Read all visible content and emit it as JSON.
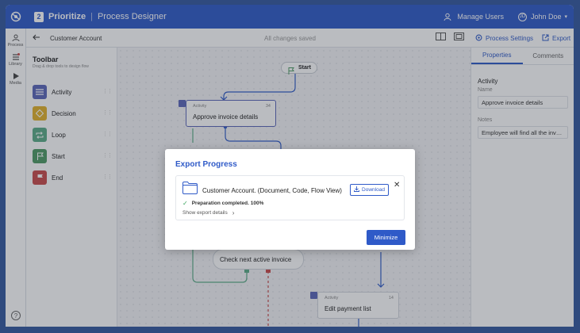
{
  "topbar": {
    "badge": "2",
    "app_name": "Prioritize",
    "separator": "|",
    "page_name": "Process Designer",
    "manage_users": "Manage Users",
    "user_initials": "JD",
    "user_name": "John Doe"
  },
  "leftrail": {
    "items": [
      {
        "label": "Process",
        "icon": "process-icon"
      },
      {
        "label": "Library",
        "icon": "library-icon"
      },
      {
        "label": "Media",
        "icon": "media-icon"
      }
    ],
    "help": "?"
  },
  "subbar": {
    "document": "Customer Account",
    "save_status": "All changes saved",
    "process_settings": "Process Settings",
    "export": "Export"
  },
  "toolbar": {
    "title": "Toolbar",
    "hint": "Drag & drop tools to design flow",
    "tools": [
      {
        "label": "Activity",
        "color": "#5b66b8",
        "icon": "list-icon"
      },
      {
        "label": "Decision",
        "color": "#e2b22a",
        "icon": "diamond-icon"
      },
      {
        "label": "Loop",
        "color": "#5bab86",
        "icon": "loop-icon"
      },
      {
        "label": "Start",
        "color": "#4d9a63",
        "icon": "flag-icon"
      },
      {
        "label": "End",
        "color": "#c94a4a",
        "icon": "flag-icon"
      }
    ]
  },
  "canvas": {
    "start": "Start",
    "nodes": [
      {
        "kind": "Activity",
        "number": "34",
        "name": "Approve invoice details"
      },
      {
        "kind": "",
        "number": "",
        "name": "Check next active invoice"
      },
      {
        "kind": "Activity",
        "number": "14",
        "name": "Edit payment list"
      }
    ]
  },
  "rightpanel": {
    "tabs": [
      "Properties",
      "Comments"
    ],
    "section": "Activity",
    "name_label": "Name",
    "name_value": "Approve invoice details",
    "notes_label": "Notes",
    "notes_value": "Employee will find all the invo..."
  },
  "modal": {
    "title": "Export Progress",
    "file": "Customer Account. (Document, Code, Flow View)",
    "download": "Download",
    "status": "Preparation completed. 100%",
    "progress": 100,
    "details": "Show export details",
    "minimize": "Minimize"
  },
  "colors": {
    "primary": "#2f5ac8",
    "success": "#3aa55d",
    "end": "#c94a4a"
  }
}
